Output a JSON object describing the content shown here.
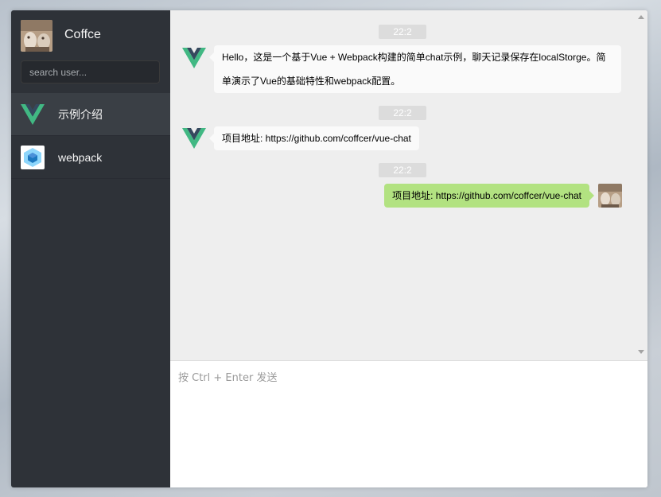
{
  "user": {
    "name": "Coffce"
  },
  "search": {
    "placeholder": "search user..."
  },
  "sessions": [
    {
      "name": "示例介绍",
      "icon": "vue-logo-icon",
      "active": true
    },
    {
      "name": "webpack",
      "icon": "webpack-logo-icon",
      "active": false
    }
  ],
  "messages": [
    {
      "time": "22:2",
      "from": "other",
      "lines": [
        "Hello，这是一个基于Vue + Webpack构建的简单chat示例，聊天记录保存在localStorge。简",
        "单演示了Vue的基础特性和webpack配置。"
      ]
    },
    {
      "time": "22:2",
      "from": "other",
      "lines": [
        "项目地址: https://github.com/coffcer/vue-chat"
      ]
    },
    {
      "time": "22:2",
      "from": "self",
      "lines": [
        "项目地址: https://github.com/coffcer/vue-chat"
      ]
    }
  ],
  "input": {
    "placeholder": "按 Ctrl + Enter 发送"
  },
  "colors": {
    "sidebar": "#2e3238",
    "chat_bg": "#eeeeee",
    "self_bubble": "#b2e281",
    "vue_green": "#41b883",
    "vue_dark": "#35495e"
  }
}
